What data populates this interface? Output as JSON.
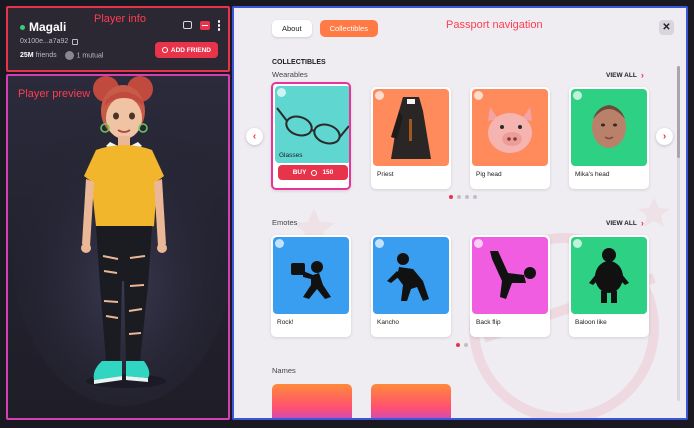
{
  "player_info": {
    "annotation": "Player info",
    "name": "Magali",
    "address": "0x100e...a7a92",
    "friends_count": "25M",
    "friends_label": "friends",
    "mutual": "1 mutual",
    "add_friend_label": "ADD FRIEND"
  },
  "player_preview": {
    "annotation": "Player preview"
  },
  "passport": {
    "annotation": "Passport navigation",
    "tabs": [
      {
        "label": "About",
        "active": false
      },
      {
        "label": "Collectibles",
        "active": true
      }
    ],
    "close_label": "✕",
    "collectibles_heading": "COLLECTIBLES",
    "wearables": {
      "title": "Wearables",
      "view_all": "VIEW ALL",
      "buy_label": "BUY",
      "buy_price": "150",
      "pagination_active": 0,
      "pagination_count": 4,
      "items": [
        {
          "name": "Glasses",
          "bg": "#5fd6d0",
          "selected": true
        },
        {
          "name": "Priest",
          "bg": "#ff8a5c"
        },
        {
          "name": "Pig head",
          "bg": "#ff8a5c"
        },
        {
          "name": "Mika's head",
          "bg": "#2ed184"
        }
      ]
    },
    "emotes": {
      "title": "Emotes",
      "view_all": "VIEW ALL",
      "pagination_active": 0,
      "pagination_count": 2,
      "items": [
        {
          "name": "Rock!",
          "bg": "#3a9ef0"
        },
        {
          "name": "Kancho",
          "bg": "#3a9ef0"
        },
        {
          "name": "Back flip",
          "bg": "#f05de0"
        },
        {
          "name": "Baloon like",
          "bg": "#2ed184"
        }
      ]
    },
    "names": {
      "title": "Names"
    }
  },
  "colors": {
    "accent": "#e8344a",
    "collectibles_tab": "#ff7a45",
    "player_info_border": "#e8344a",
    "player_preview_border": "#d63fb2",
    "passport_border": "#3c56d9"
  }
}
